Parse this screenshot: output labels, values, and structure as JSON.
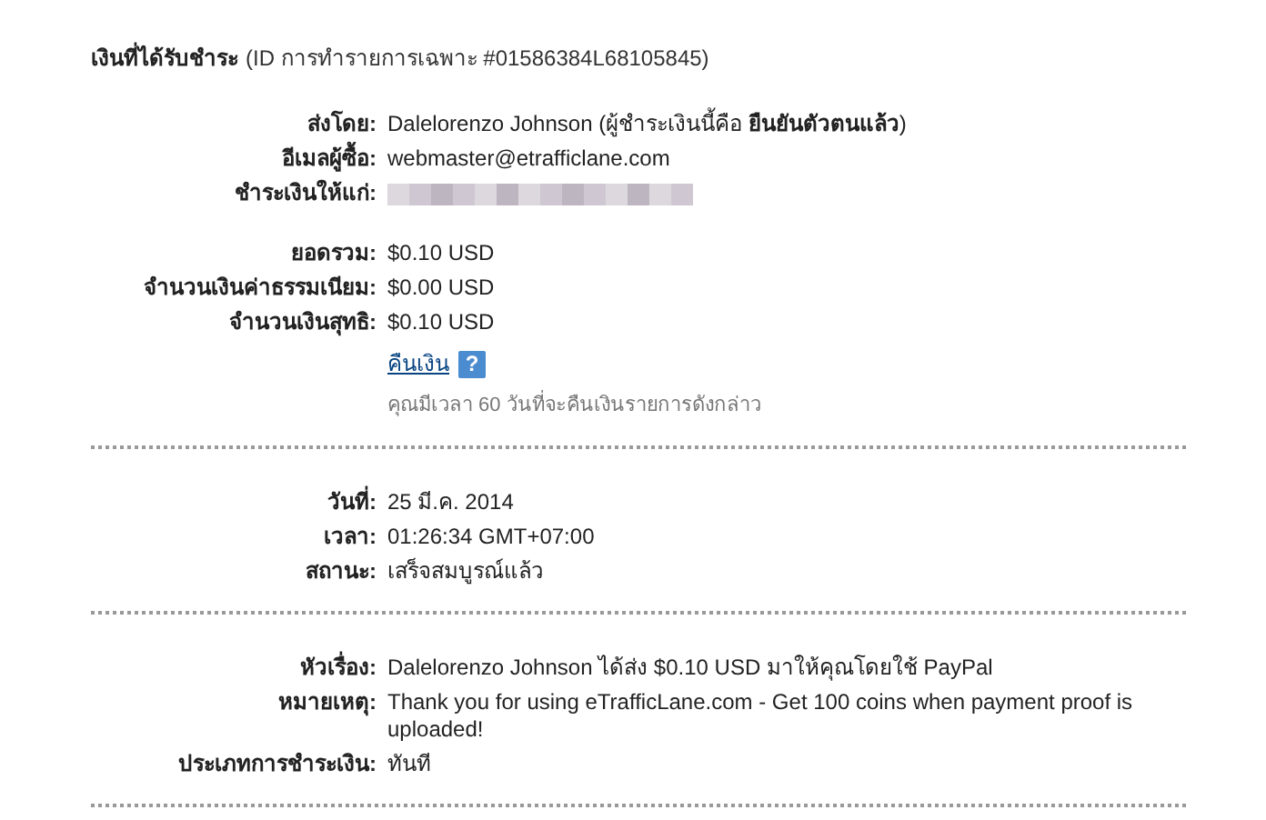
{
  "header": {
    "title": "เงินที่ได้รับชำระ",
    "subtitle": "(ID การทำรายการเฉพาะ #01586384L68105845)"
  },
  "sections": [
    {
      "groups": [
        [
          {
            "kind": "text",
            "label": "ส่งโดย:",
            "value": "Dalelorenzo Johnson (ผู้ชำระเงินนี้คือ **ยืนยันตัวตนแล้ว**)"
          },
          {
            "kind": "text",
            "label": "อีเมลผู้ซื้อ:",
            "value": "webmaster@etrafficlane.com"
          },
          {
            "kind": "redacted",
            "label": "ชำระเงินให้แก่:"
          }
        ],
        [
          {
            "kind": "text",
            "label": "ยอดรวม:",
            "value": "$0.10 USD"
          },
          {
            "kind": "text",
            "label": "จำนวนเงินค่าธรรมเนียม:",
            "value": "$0.00 USD"
          },
          {
            "kind": "text",
            "label": "จำนวนเงินสุทธิ:",
            "value": "$0.10 USD"
          },
          {
            "kind": "link",
            "value": "คืนเงิน",
            "icon_text": "?"
          },
          {
            "kind": "note",
            "value": "คุณมีเวลา 60 วันที่จะคืนเงินรายการดังกล่าว"
          }
        ]
      ]
    },
    {
      "groups": [
        [
          {
            "kind": "text",
            "label": "วันที่:",
            "value": "25 มี.ค. 2014"
          },
          {
            "kind": "text",
            "label": "เวลา:",
            "value": "01:26:34 GMT+07:00"
          },
          {
            "kind": "text",
            "label": "สถานะ:",
            "value": "เสร็จสมบูรณ์แล้ว"
          }
        ]
      ]
    },
    {
      "groups": [
        [
          {
            "kind": "text",
            "label": "หัวเรื่อง:",
            "value": "Dalelorenzo Johnson ได้ส่ง $0.10 USD มาให้คุณโดยใช้ PayPal"
          },
          {
            "kind": "text",
            "label": "หมายเหตุ:",
            "value": "Thank you for using eTrafficLane.com - Get 100 coins when payment proof is uploaded!"
          },
          {
            "kind": "text",
            "label": "ประเภทการชำระเงิน:",
            "value": "ทันที"
          }
        ]
      ]
    }
  ]
}
